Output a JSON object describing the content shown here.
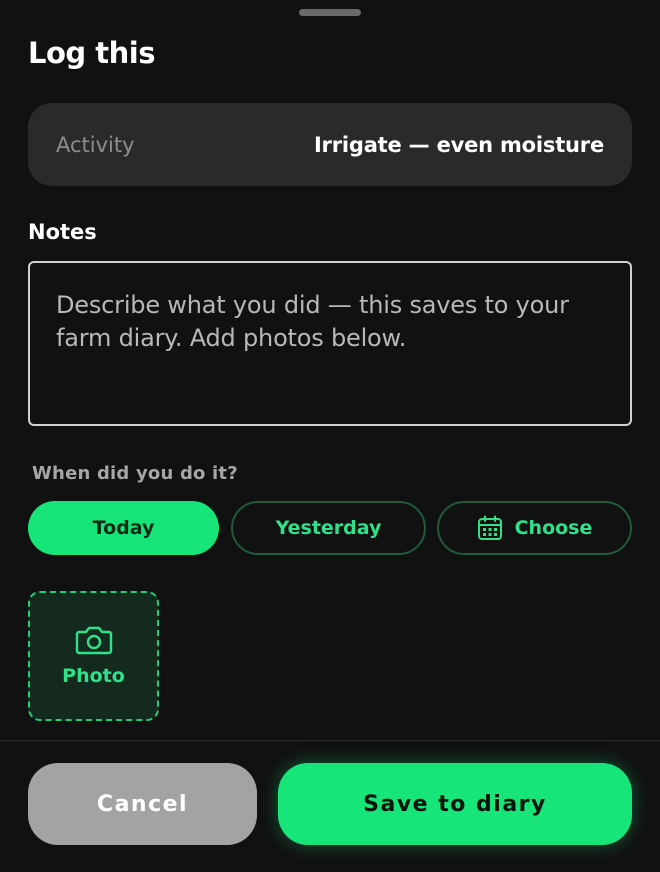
{
  "sheet": {
    "title": "Log this"
  },
  "activity": {
    "label": "Activity",
    "value": "Irrigate — even moisture"
  },
  "notes": {
    "label": "Notes",
    "placeholder": "Describe what you did — this saves to your farm diary. Add photos below."
  },
  "when": {
    "label": "When did you do it?",
    "options": [
      {
        "label": "Today",
        "selected": true
      },
      {
        "label": "Yesterday",
        "selected": false
      },
      {
        "label": "Choose",
        "selected": false,
        "icon": "calendar-icon"
      }
    ]
  },
  "photo": {
    "label": "Photo",
    "icon": "camera-icon"
  },
  "actions": {
    "cancel_label": "Cancel",
    "save_label": "Save to diary"
  },
  "colors": {
    "accent": "#17e57a",
    "background": "#111111",
    "surface": "#2a2a2a",
    "cancel": "#a3a3a3"
  }
}
